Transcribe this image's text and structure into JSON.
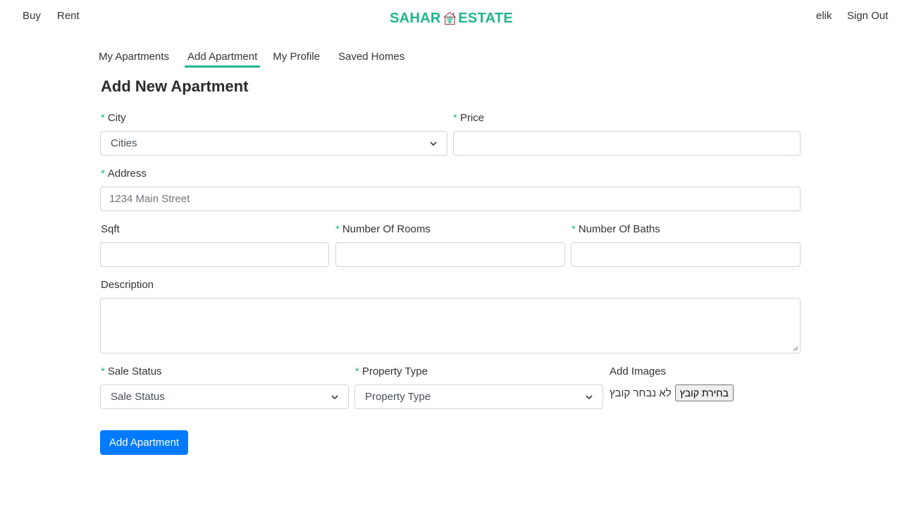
{
  "topnav": {
    "buy": "Buy",
    "rent": "Rent",
    "user": "elik",
    "signout": "Sign Out"
  },
  "logo": {
    "left": "SAHAR",
    "right": "ESTATE",
    "color": "#1fb58f",
    "house_color": "#a0525f"
  },
  "tabs": [
    {
      "label": "My Apartments"
    },
    {
      "label": "Add Apartment",
      "active": true
    },
    {
      "label": "My Profile"
    },
    {
      "label": "Saved Homes"
    }
  ],
  "form": {
    "title": "Add New Apartment",
    "required_marker": "*",
    "city": {
      "label": "City",
      "value": "Cities"
    },
    "price": {
      "label": "Price",
      "value": ""
    },
    "address": {
      "label": "Address",
      "placeholder": "1234 Main Street"
    },
    "sqft": {
      "label": "Sqft",
      "value": ""
    },
    "rooms": {
      "label": "Number Of Rooms",
      "value": ""
    },
    "baths": {
      "label": "Number Of Baths",
      "value": ""
    },
    "description": {
      "label": "Description",
      "value": ""
    },
    "sale_status": {
      "label": "Sale Status",
      "value": "Sale Status"
    },
    "property_type": {
      "label": "Property Type",
      "value": "Property Type"
    },
    "images": {
      "label": "Add Images",
      "button": "בחירת קובץ",
      "status": "לא נבחר קובץ"
    },
    "submit": "Add Apartment"
  },
  "colors": {
    "accent": "#1fb58f",
    "primary_button": "#007bff"
  }
}
